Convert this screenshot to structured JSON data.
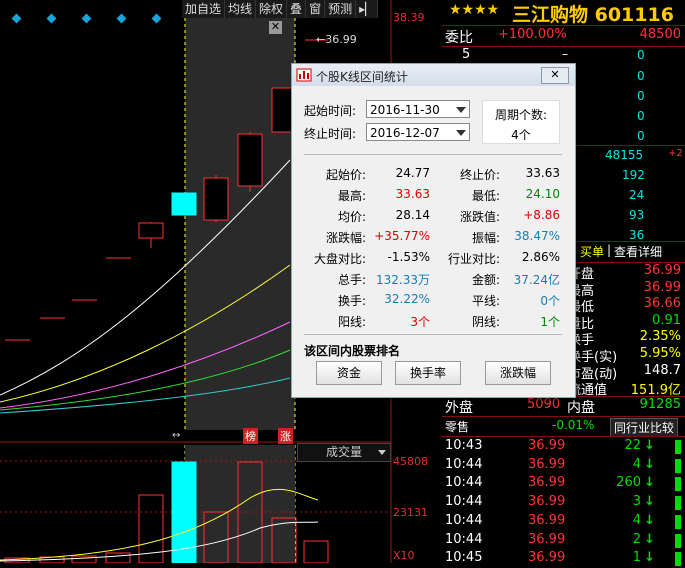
{
  "toolbar": {
    "items": [
      "加自选",
      "均线",
      "除权",
      "叠",
      "窗",
      "预测",
      "▸▏"
    ]
  },
  "chart": {
    "price_top": "38.39",
    "price_marker": "←36.99",
    "bottom_labels": [
      "榜",
      "涨"
    ],
    "volume_selector": "成交量",
    "volume_labels": [
      "45808",
      "23131",
      "X10"
    ]
  },
  "dialog": {
    "title": "个股K线区间统计",
    "start_label": "起始时间:",
    "start_value": "2016-11-30",
    "end_label": "终止时间:",
    "end_value": "2016-12-07",
    "period_label": "周期个数:",
    "period_value": "4个",
    "stats": [
      {
        "l1": "起始价:",
        "v1": "24.77",
        "c1": "#000",
        "l2": "终止价:",
        "v2": "33.63",
        "c2": "#000"
      },
      {
        "l1": "最高:",
        "v1": "33.63",
        "c1": "#e00000",
        "l2": "最低:",
        "v2": "24.10",
        "c2": "#008800"
      },
      {
        "l1": "均价:",
        "v1": "28.14",
        "c1": "#000",
        "l2": "涨跌值:",
        "v2": "+8.86",
        "c2": "#e00000"
      },
      {
        "l1": "涨跌幅:",
        "v1": "+35.77%",
        "c1": "#e00000",
        "l2": "振幅:",
        "v2": "38.47%",
        "c2": "#1a7bb0"
      },
      {
        "l1": "大盘对比:",
        "v1": "-1.53%",
        "c1": "#000",
        "l2": "行业对比:",
        "v2": "2.86%",
        "c2": "#000"
      },
      {
        "l1": "总手:",
        "v1": "132.33万",
        "c1": "#1a7bb0",
        "l2": "金额:",
        "v2": "37.24亿",
        "c2": "#1a7bb0"
      },
      {
        "l1": "换手:",
        "v1": "32.22%",
        "c1": "#1a7bb0",
        "l2": "平线:",
        "v2": "0个",
        "c2": "#1a7bb0"
      },
      {
        "l1": "阳线:",
        "v1": "3个",
        "c1": "#e00000",
        "l2": "阴线:",
        "v2": "1个",
        "c2": "#008800"
      }
    ],
    "rank_title": "该区间内股票排名",
    "buttons": [
      "资金",
      "换手率",
      "涨跌幅"
    ]
  },
  "quote": {
    "stars": "★★★★",
    "name": "三江购物 601116",
    "weibi_label": "委比",
    "weibi_pct": "+100.00%",
    "weibi_val": "48500",
    "book_num": "5",
    "book_dash": "–",
    "zeros": [
      "0",
      "0",
      "0",
      "0",
      "0"
    ],
    "vol1": "48155",
    "vol1_mark": "+2",
    "mid_vals": [
      "192",
      "24",
      "93",
      "36"
    ],
    "buy_text": "买单",
    "detail_text": "查看详细",
    "fields": [
      {
        "label": "开盘",
        "value": "36.99",
        "color": "#ff3333"
      },
      {
        "label": "最高",
        "value": "36.99",
        "color": "#ff3333"
      },
      {
        "label": "最低",
        "value": "36.66",
        "color": "#ff3333"
      },
      {
        "label": "量比",
        "value": "0.91",
        "color": "#00dd00"
      },
      {
        "label": "换手",
        "value": "2.35%",
        "color": "#ffff00"
      },
      {
        "label": "换手(实)",
        "value": "5.95%",
        "color": "#ffff00"
      },
      {
        "label": "市盈(动)",
        "value": "148.7",
        "color": "#ffffff"
      },
      {
        "label": "流通值",
        "value": "151.9亿",
        "color": "#ffff00"
      }
    ],
    "waipan_label": "外盘",
    "waipan_val": "5090",
    "neipan_label": "内盘",
    "neipan_val": "91285",
    "lingshou": "零售",
    "lingshou_pct": "-0.01%",
    "compare_btn": "同行业比较",
    "ticks": [
      {
        "time": "10:43",
        "price": "36.99",
        "vol": "22",
        "dir": "down"
      },
      {
        "time": "10:44",
        "price": "36.99",
        "vol": "4",
        "dir": "down"
      },
      {
        "time": "10:44",
        "price": "36.99",
        "vol": "260",
        "dir": "down"
      },
      {
        "time": "10:44",
        "price": "36.99",
        "vol": "3",
        "dir": "down"
      },
      {
        "time": "10:44",
        "price": "36.99",
        "vol": "4",
        "dir": "down"
      },
      {
        "time": "10:44",
        "price": "36.99",
        "vol": "2",
        "dir": "down"
      },
      {
        "time": "10:45",
        "price": "36.99",
        "vol": "1",
        "dir": "down"
      }
    ]
  },
  "colors": {
    "up": "#ff3333",
    "down": "#00dd00",
    "accent": "#ffcc00"
  }
}
